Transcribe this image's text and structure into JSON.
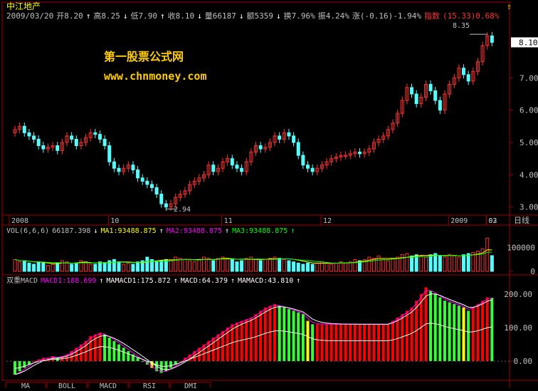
{
  "header": {
    "title": "中江地产",
    "arrow_icon": "up-arrow-icon",
    "quote": [
      {
        "text": "2009/03/20",
        "color": "#c0c0c0"
      },
      {
        "text": "开8.20",
        "color": "#c0c0c0"
      },
      {
        "text": "↑",
        "color": "#ffffff"
      },
      {
        "text": "高8.25",
        "color": "#c0c0c0"
      },
      {
        "text": "↓",
        "color": "#ffffff"
      },
      {
        "text": "低7.90",
        "color": "#c0c0c0"
      },
      {
        "text": "↑",
        "color": "#ffffff"
      },
      {
        "text": "收8.10",
        "color": "#c0c0c0"
      },
      {
        "text": "↓",
        "color": "#ffffff"
      },
      {
        "text": "量66187",
        "color": "#c0c0c0"
      },
      {
        "text": "↓",
        "color": "#ffffff"
      },
      {
        "text": "额5359",
        "color": "#c0c0c0"
      },
      {
        "text": "↓",
        "color": "#ffffff"
      },
      {
        "text": "换7.96%",
        "color": "#c0c0c0"
      },
      {
        "text": "振4.24%",
        "color": "#c0c0c0"
      },
      {
        "text": "涨(-0.16)-1.94%",
        "color": "#c0c0c0"
      },
      {
        "text": "指数",
        "color": "#ff3232"
      },
      {
        "text": "(15.33)0.68%",
        "color": "#ff3232"
      }
    ]
  },
  "watermark": {
    "line1": "第一股票公式网",
    "line2": "www.chnmoney.com"
  },
  "price_axis": {
    "current_label": "8.10",
    "ticks": [
      {
        "value": 7,
        "label": "7.00"
      },
      {
        "value": 6,
        "label": "6.00"
      },
      {
        "value": 5,
        "label": "5.00"
      },
      {
        "value": 4,
        "label": "4.00"
      },
      {
        "value": 3,
        "label": "3.00"
      }
    ]
  },
  "annotations": {
    "high": "8.35",
    "low": "2.94"
  },
  "date_bar": {
    "labels": [
      "2008",
      "10",
      "11",
      "12",
      "2009",
      "02",
      "03"
    ],
    "period": "日线"
  },
  "volume": {
    "legend": [
      {
        "text": "VOL(6,6,6)",
        "color": "#c0c0c0"
      },
      {
        "text": "66187.398",
        "color": "#c0c0c0"
      },
      {
        "text": "↓",
        "color": "#ffffff"
      },
      {
        "text": "MA1:93488.875",
        "color": "#ffff00"
      },
      {
        "text": "↑",
        "color": "#ffffff"
      },
      {
        "text": "MA2:93488.875",
        "color": "#ff00ff"
      },
      {
        "text": "↑",
        "color": "#ffffff"
      },
      {
        "text": "MA3:93488.875",
        "color": "#00ff00"
      },
      {
        "text": "↑",
        "color": "#00ff00"
      }
    ],
    "ticks": [
      {
        "value": 100000,
        "label": "100000"
      },
      {
        "value": 0,
        "label": "0"
      }
    ]
  },
  "macd": {
    "legend": [
      {
        "text": "双重MACD",
        "color": "#c0c0c0"
      },
      {
        "text": "MACD1:188.699",
        "color": "#ff00ff"
      },
      {
        "text": "↑",
        "color": "#ffffff"
      },
      {
        "text": "MAMACD1:175.872",
        "color": "#ffffff"
      },
      {
        "text": "↑",
        "color": "#ffffff"
      },
      {
        "text": "MACD:64.379",
        "color": "#ffffff"
      },
      {
        "text": "↑",
        "color": "#ffffff"
      },
      {
        "text": "MAMACD:43.810",
        "color": "#ffffff"
      },
      {
        "text": "↑",
        "color": "#ffffff"
      }
    ],
    "ticks": [
      {
        "value": 200,
        "label": "200.00"
      },
      {
        "value": 100,
        "label": "100.00"
      },
      {
        "value": 0,
        "label": "0.00"
      }
    ]
  },
  "bottom_tabs": [
    "MA",
    "BOLL",
    "MACD",
    "RSI",
    "DMI"
  ],
  "colors": {
    "up": "#ff3232",
    "down": "#54ffff",
    "grid": "#a00000",
    "axis_text": "#c0c0c0",
    "macd_red": "#ff0000",
    "macd_green": "#33ff33",
    "macd_yellow": "#ffff00"
  },
  "chart_data": {
    "type": "bar",
    "series": [
      {
        "name": "",
        "values": [
          5.4,
          5.5,
          5.3,
          5.2,
          5.1,
          4.9,
          4.8,
          4.85,
          4.9,
          4.75,
          5.0,
          5.2,
          5.1,
          4.9,
          5.0,
          5.15,
          5.3,
          5.25,
          5.1,
          4.9,
          4.4,
          4.2,
          4.1,
          4.2,
          4.3,
          4.15,
          3.9,
          3.8,
          3.7,
          3.6,
          3.4,
          3.1,
          3.0,
          3.1,
          3.3,
          3.4,
          3.5,
          3.7,
          3.8,
          3.9,
          4.0,
          4.3,
          4.1,
          4.2,
          4.4,
          4.5,
          4.3,
          4.2,
          4.1,
          4.4,
          4.7,
          4.9,
          4.8,
          4.85,
          5.0,
          5.2,
          5.1,
          5.3,
          5.2,
          5.0,
          4.6,
          4.3,
          4.2,
          4.1,
          4.2,
          4.3,
          4.4,
          4.5,
          4.55,
          4.6,
          4.6,
          4.65,
          4.7,
          4.65,
          4.7,
          4.8,
          5.0,
          5.1,
          5.2,
          5.4,
          5.6,
          5.9,
          6.3,
          6.7,
          6.5,
          6.2,
          6.4,
          6.8,
          6.6,
          6.3,
          6.0,
          6.5,
          6.8,
          7.0,
          7.3,
          7.1,
          6.9,
          7.2,
          7.5,
          8.0,
          8.3,
          8.1
        ]
      },
      {
        "name": "VOL",
        "values": [
          50000,
          40000,
          45000,
          35000,
          30000,
          40000,
          35000,
          25000,
          30000,
          35000,
          45000,
          40000,
          30000,
          35000,
          45000,
          40000,
          30000,
          30000,
          40000,
          35000,
          45000,
          50000,
          40000,
          30000,
          35000,
          30000,
          40000,
          45000,
          60000,
          50000,
          40000,
          45000,
          50000,
          45000,
          60000,
          55000,
          50000,
          45000,
          40000,
          50000,
          60000,
          55000,
          45000,
          55000,
          60000,
          55000,
          50000,
          40000,
          45000,
          55000,
          60000,
          50000,
          45000,
          50000,
          55000,
          60000,
          55000,
          50000,
          45000,
          40000,
          35000,
          30000,
          35000,
          30000,
          35000,
          40000,
          35000,
          30000,
          35000,
          40000,
          35000,
          40000,
          50000,
          45000,
          50000,
          60000,
          55000,
          65000,
          50000,
          45000,
          55000,
          60000,
          70000,
          75000,
          65000,
          70000,
          65000,
          60000,
          70000,
          75000,
          65000,
          60000,
          70000,
          65000,
          60000,
          70000,
          75000,
          80000,
          85000,
          95000,
          140000,
          66187
        ]
      },
      {
        "name": "MACD",
        "values": [
          -40,
          -30,
          -20,
          -10,
          0,
          5,
          10,
          10,
          15,
          10,
          15,
          20,
          30,
          40,
          50,
          60,
          75,
          80,
          85,
          80,
          70,
          60,
          50,
          40,
          30,
          20,
          10,
          0,
          -10,
          -20,
          -30,
          -35,
          -30,
          -20,
          -10,
          0,
          10,
          20,
          30,
          40,
          50,
          60,
          70,
          80,
          90,
          100,
          110,
          115,
          120,
          125,
          130,
          140,
          150,
          160,
          165,
          170,
          165,
          160,
          155,
          150,
          145,
          140,
          120,
          110,
          110,
          110,
          110,
          110,
          110,
          110,
          110,
          110,
          110,
          110,
          110,
          110,
          110,
          110,
          110,
          110,
          120,
          130,
          140,
          150,
          160,
          180,
          200,
          220,
          210,
          200,
          190,
          180,
          175,
          170,
          165,
          160,
          150,
          160,
          170,
          180,
          190,
          188.699
        ]
      }
    ]
  }
}
